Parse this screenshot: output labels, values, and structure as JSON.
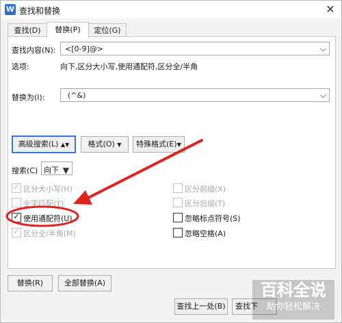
{
  "window": {
    "title": "查找和替换"
  },
  "tabs": [
    {
      "label": "查找(D)"
    },
    {
      "label": "替换(P)"
    },
    {
      "label": "定位(G)"
    }
  ],
  "find": {
    "label": "查找内容(N):",
    "value": "<[0-9]@>"
  },
  "options": {
    "label": "选项:",
    "summary": "向下,区分大小写,使用通配符,区分全/半角"
  },
  "replace": {
    "label": "替换为(I):",
    "value": "(^&)"
  },
  "buttons": {
    "advanced": "高级搜索(L)",
    "format": "格式(O)",
    "special": "特殊格式(E)",
    "replace": "替换(R)",
    "replace_all": "全部替换(A)",
    "find_prev": "查找上一处(B)",
    "find_next": "查找下"
  },
  "search": {
    "label": "搜索(C)",
    "value": "向下"
  },
  "checkboxes_left": [
    {
      "label": "区分大小写(H)",
      "checked": true,
      "enabled": false
    },
    {
      "label": "全字匹配(Y)",
      "checked": false,
      "enabled": false
    },
    {
      "label": "使用通配符(U)",
      "checked": true,
      "enabled": true
    },
    {
      "label": "区分全/半角(M)",
      "checked": true,
      "enabled": false
    }
  ],
  "checkboxes_right": [
    {
      "label": "区分前缀(X)",
      "checked": false,
      "enabled": false
    },
    {
      "label": "区分后缀(T)",
      "checked": false,
      "enabled": false
    },
    {
      "label": "忽略标点符号(S)",
      "checked": false,
      "enabled": true
    },
    {
      "label": "忽略空格(A)",
      "checked": false,
      "enabled": true
    }
  ],
  "watermark": {
    "main": "百科全说",
    "sub": "助你轻松解决"
  },
  "colors": {
    "annotation": "#e0221f",
    "focus": "#2f7ad8",
    "watermark": "#ffffff"
  }
}
